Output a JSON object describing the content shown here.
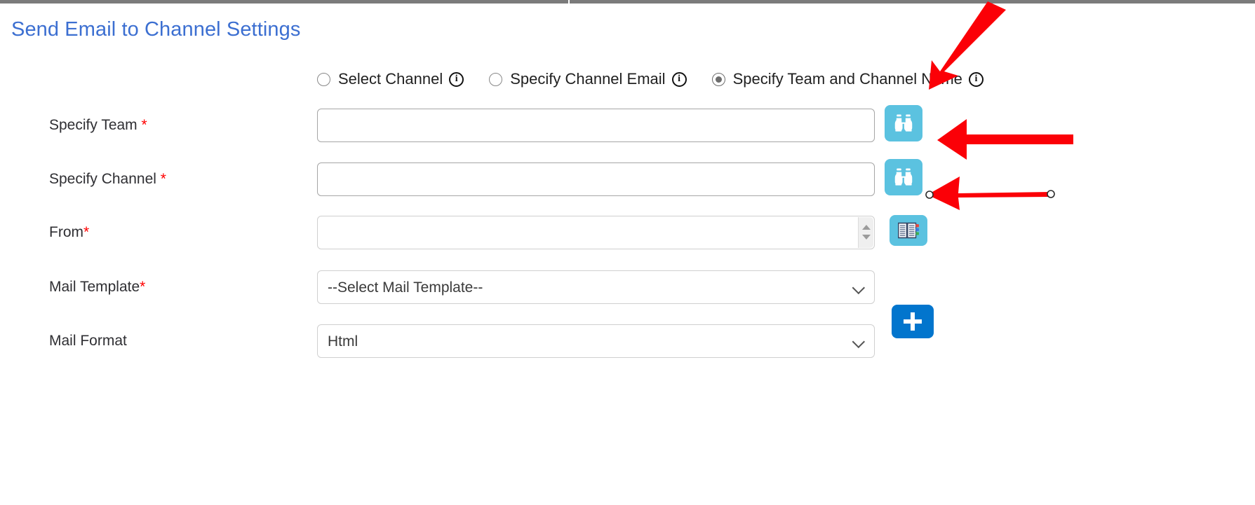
{
  "page": {
    "title": "Send Email to Channel Settings",
    "title_color": "#3c6fd1"
  },
  "topbar": {
    "present": true,
    "color": "#7b7b7b"
  },
  "channel_mode": {
    "options": [
      {
        "label": "Select Channel",
        "selected": false,
        "info_glyph": "i"
      },
      {
        "label": "Specify Channel Email",
        "selected": false,
        "info_glyph": "i"
      },
      {
        "label": "Specify Team and Channel Name",
        "selected": true,
        "info_glyph": "i"
      }
    ]
  },
  "form": {
    "rows": [
      {
        "label": "Specify Team",
        "required_mark": "*",
        "required_spaced": true,
        "control": "text",
        "value": "",
        "placeholder": "",
        "button": {
          "name": "browse-team-button",
          "icon": "binoculars-icon",
          "color": "#5bc2e0"
        }
      },
      {
        "label": "Specify Channel",
        "required_mark": "*",
        "required_spaced": true,
        "control": "text",
        "value": "",
        "placeholder": "",
        "button": {
          "name": "browse-channel-button",
          "icon": "binoculars-icon",
          "color": "#5bc2e0"
        }
      },
      {
        "label": "From",
        "required_mark": "*",
        "required_spaced": false,
        "control": "stepper",
        "value": "",
        "placeholder": "",
        "button": {
          "name": "address-book-button",
          "icon": "address-book-icon",
          "color": "#5bc2e0"
        }
      },
      {
        "label": "Mail Template",
        "required_mark": "*",
        "required_spaced": false,
        "control": "select",
        "value": "--Select Mail Template--",
        "options": [
          "--Select Mail Template--"
        ],
        "button": {
          "name": "add-mail-template-button",
          "icon": "plus-icon",
          "color": "#0275cd"
        }
      },
      {
        "label": "Mail Format",
        "required_mark": "",
        "required_spaced": false,
        "control": "select",
        "value": "Html",
        "options": [
          "Html"
        ],
        "button": null
      }
    ]
  },
  "annotations": {
    "color": "#fb0007",
    "arrows": [
      {
        "name": "arrow-to-specify-team-and-channel-radio",
        "kind": "diagonal",
        "selected": false
      },
      {
        "name": "arrow-to-team-browse-button",
        "kind": "horizontal",
        "selected": false
      },
      {
        "name": "arrow-to-channel-browse-button",
        "kind": "horizontal",
        "selected": true
      }
    ]
  }
}
